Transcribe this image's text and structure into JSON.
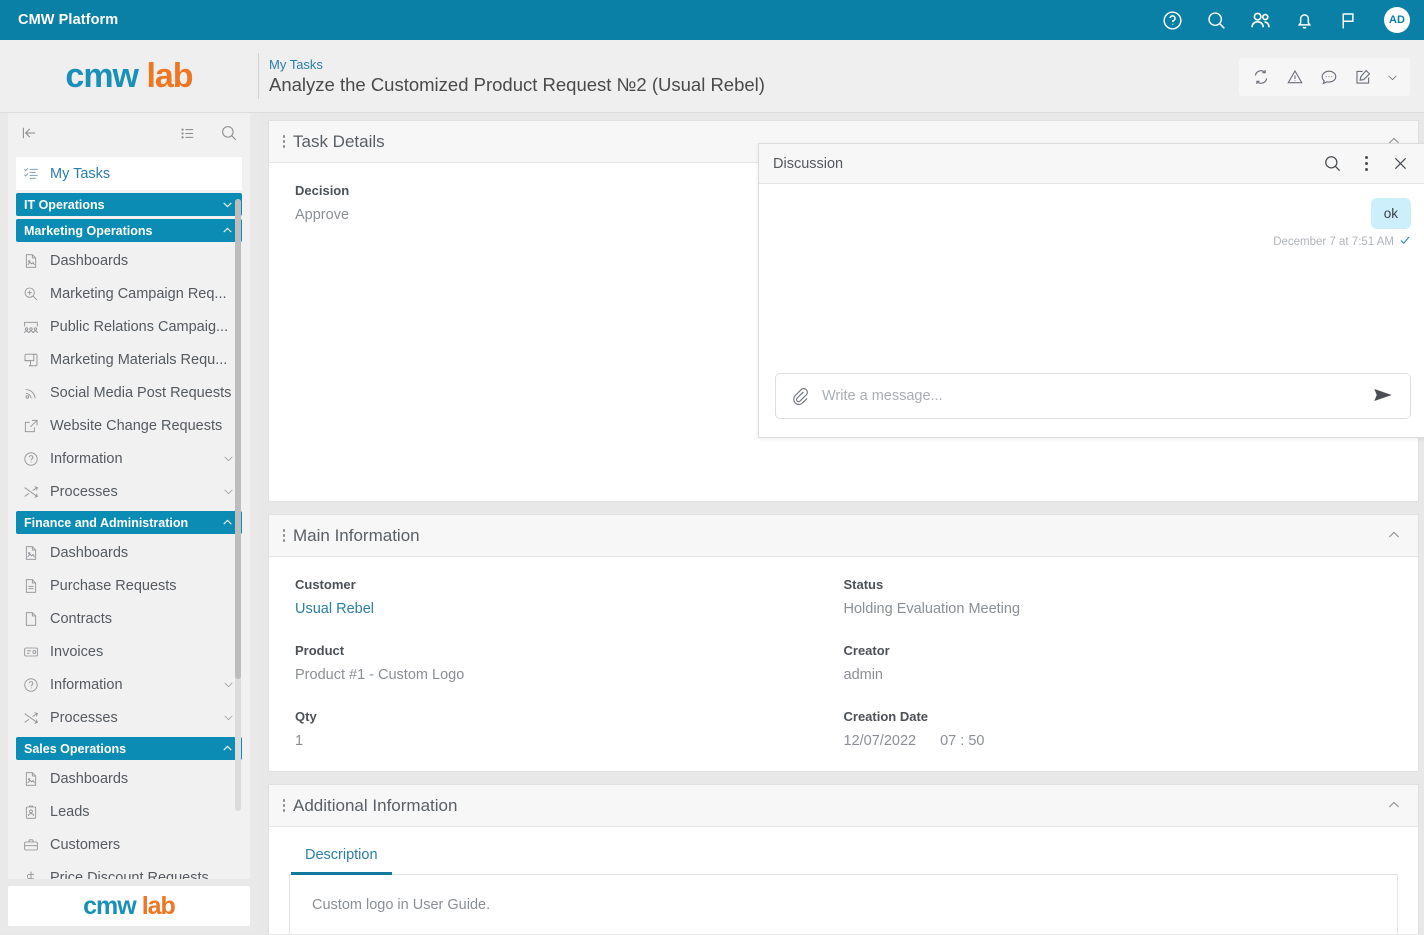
{
  "topbar": {
    "title": "CMW Platform",
    "icons": [
      "help-circle-icon",
      "search-icon",
      "users-icon",
      "bell-icon",
      "flag-icon"
    ],
    "avatar_initials": "AD",
    "accent_color": "#0a80a6"
  },
  "header": {
    "logo_part1": "cmw",
    "logo_part2": "lab",
    "breadcrumb": "My Tasks",
    "page_title": "Analyze the Customized Product Request №2 (Usual Rebel)",
    "tools": [
      "sync-icon",
      "warning-triangle-icon",
      "comment-icon",
      "edit-pencil-icon",
      "chevron-down-icon"
    ]
  },
  "sidebar": {
    "toolbar": [
      "collapse-left-icon",
      "list-icon",
      "search-icon"
    ],
    "items": [
      {
        "type": "item",
        "label": "My Tasks",
        "icon": "task-list-icon",
        "active": true
      },
      {
        "type": "group",
        "label": "IT Operations",
        "expanded": false
      },
      {
        "type": "group",
        "label": "Marketing Operations",
        "expanded": true
      },
      {
        "type": "item",
        "label": "Dashboards",
        "icon": "file-image-icon"
      },
      {
        "type": "item",
        "label": "Marketing Campaign Req...",
        "icon": "zoom-in-icon"
      },
      {
        "type": "item",
        "label": "Public Relations Campaig...",
        "icon": "people-group-icon"
      },
      {
        "type": "item",
        "label": "Marketing Materials Requ...",
        "icon": "scroll-icon"
      },
      {
        "type": "item",
        "label": "Social Media Post Requests",
        "icon": "broadcast-icon"
      },
      {
        "type": "item",
        "label": "Website Change Requests",
        "icon": "external-link-icon"
      },
      {
        "type": "item",
        "label": "Information",
        "icon": "question-circle-icon",
        "chevron": true
      },
      {
        "type": "item",
        "label": "Processes",
        "icon": "shuffle-icon",
        "chevron": true
      },
      {
        "type": "group",
        "label": "Finance and Administration",
        "expanded": true
      },
      {
        "type": "item",
        "label": "Dashboards",
        "icon": "file-image-icon"
      },
      {
        "type": "item",
        "label": "Purchase Requests",
        "icon": "file-text-icon"
      },
      {
        "type": "item",
        "label": "Contracts",
        "icon": "file-blank-icon"
      },
      {
        "type": "item",
        "label": "Invoices",
        "icon": "invoice-card-icon"
      },
      {
        "type": "item",
        "label": "Information",
        "icon": "question-circle-icon",
        "chevron": true
      },
      {
        "type": "item",
        "label": "Processes",
        "icon": "shuffle-icon",
        "chevron": true
      },
      {
        "type": "group",
        "label": "Sales Operations",
        "expanded": true
      },
      {
        "type": "item",
        "label": "Dashboards",
        "icon": "file-image-icon"
      },
      {
        "type": "item",
        "label": "Leads",
        "icon": "badge-person-icon"
      },
      {
        "type": "item",
        "label": "Customers",
        "icon": "briefcase-icon"
      },
      {
        "type": "item",
        "label": "Price Discount Requests",
        "icon": "dollar-icon"
      }
    ],
    "footer_logo_part1": "cmw",
    "footer_logo_part2": "lab"
  },
  "task_details": {
    "title": "Task Details",
    "decision_label": "Decision",
    "decision_value": "Approve"
  },
  "discussion": {
    "title": "Discussion",
    "messages": [
      {
        "text": "ok",
        "timestamp": "December 7 at 7:51 AM",
        "read": true
      }
    ],
    "input_placeholder": "Write a message...",
    "input_value": "",
    "bubble_color": "#cdeefb"
  },
  "main_information": {
    "title": "Main Information",
    "left": [
      {
        "label": "Customer",
        "value": "Usual Rebel",
        "is_link": true
      },
      {
        "label": "Product",
        "value": "Product #1 - Custom Logo",
        "is_link": false
      },
      {
        "label": "Qty",
        "value": "1",
        "is_link": false
      }
    ],
    "right": [
      {
        "label": "Status",
        "value": "Holding Evaluation Meeting",
        "is_link": false
      },
      {
        "label": "Creator",
        "value": "admin",
        "is_link": false
      },
      {
        "label": "Creation Date",
        "value": "12/07/2022",
        "value2": "07 : 50",
        "is_link": false
      }
    ]
  },
  "additional_information": {
    "title": "Additional Information",
    "tabs": [
      {
        "label": "Description",
        "active": true
      }
    ],
    "description_text": "Custom logo in User Guide."
  }
}
